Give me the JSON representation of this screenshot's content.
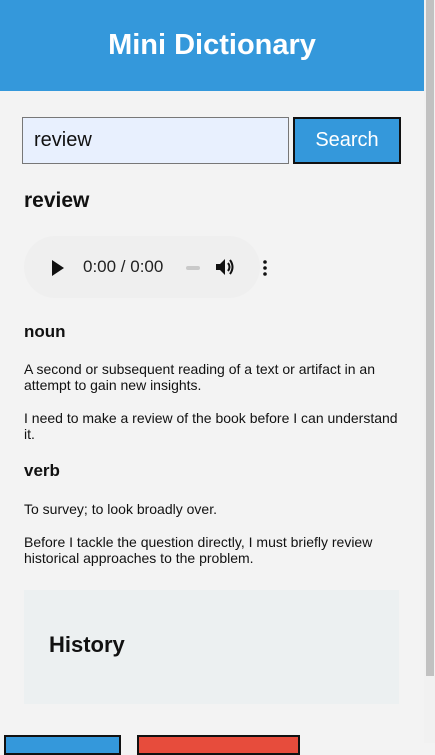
{
  "app": {
    "title": "Mini Dictionary"
  },
  "search": {
    "value": "review",
    "button_label": "Search"
  },
  "entry": {
    "word": "review",
    "audio": {
      "time": "0:00 / 0:00"
    },
    "meanings": [
      {
        "part_of_speech": "noun",
        "definition": "A second or subsequent reading of a text or artifact in an attempt to gain new insights.",
        "example": "I need to make a review of the book before I can understand it."
      },
      {
        "part_of_speech": "verb",
        "definition": "To survey; to look broadly over.",
        "example": "Before I tackle the question directly, I must briefly review historical approaches to the problem."
      }
    ]
  },
  "history": {
    "title": "History"
  },
  "colors": {
    "accent": "#3498db",
    "danger": "#e74c3c",
    "panel": "#ecf0f1"
  }
}
